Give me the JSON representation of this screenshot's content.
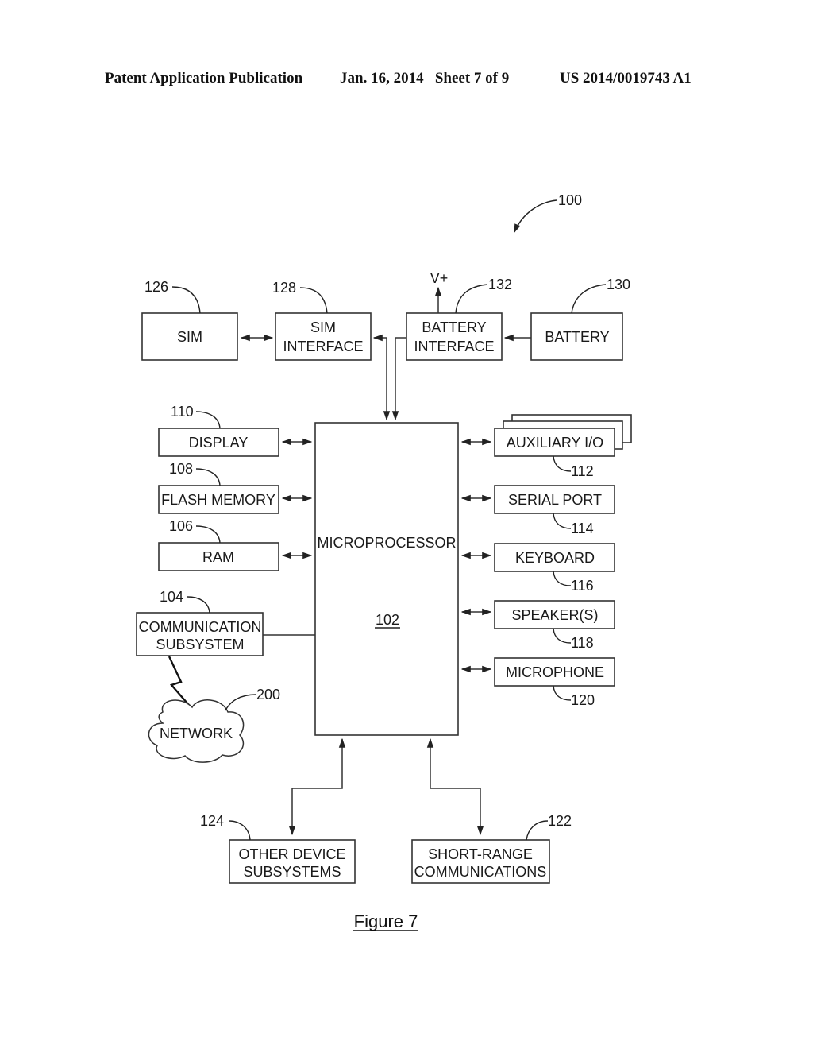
{
  "header": {
    "publication": "Patent Application Publication",
    "date_sheet": "Jan. 16, 2014   Sheet 7 of 9",
    "number": "US 2014/0019743 A1"
  },
  "figure": {
    "ref": "100",
    "caption": "Figure 7",
    "v_plus": "V+",
    "microprocessor": {
      "label": "MICROPROCESSOR",
      "ref": "102"
    },
    "top_blocks": {
      "sim": {
        "label": "SIM",
        "ref": "126"
      },
      "sim_interface": {
        "line1": "SIM",
        "line2": "INTERFACE",
        "ref": "128"
      },
      "battery_interface": {
        "line1": "BATTERY",
        "line2": "INTERFACE",
        "ref": "132"
      },
      "battery": {
        "label": "BATTERY",
        "ref": "130"
      }
    },
    "left_blocks": {
      "display": {
        "label": "DISPLAY",
        "ref": "110"
      },
      "flash": {
        "label": "FLASH MEMORY",
        "ref": "108"
      },
      "ram": {
        "label": "RAM",
        "ref": "106"
      },
      "comm": {
        "line1": "COMMUNICATION",
        "line2": "SUBSYSTEM",
        "ref": "104"
      },
      "network": {
        "label": "NETWORK",
        "ref": "200"
      }
    },
    "right_blocks": {
      "aux": {
        "label": "AUXILIARY I/O",
        "ref": "112"
      },
      "serial": {
        "label": "SERIAL PORT",
        "ref": "114"
      },
      "keyboard": {
        "label": "KEYBOARD",
        "ref": "116"
      },
      "speaker": {
        "label": "SPEAKER(S)",
        "ref": "118"
      },
      "microphone": {
        "label": "MICROPHONE",
        "ref": "120"
      }
    },
    "bottom_blocks": {
      "other": {
        "line1": "OTHER DEVICE",
        "line2": "SUBSYSTEMS",
        "ref": "124"
      },
      "short_range": {
        "line1": "SHORT-RANGE",
        "line2": "COMMUNICATIONS",
        "ref": "122"
      }
    }
  }
}
